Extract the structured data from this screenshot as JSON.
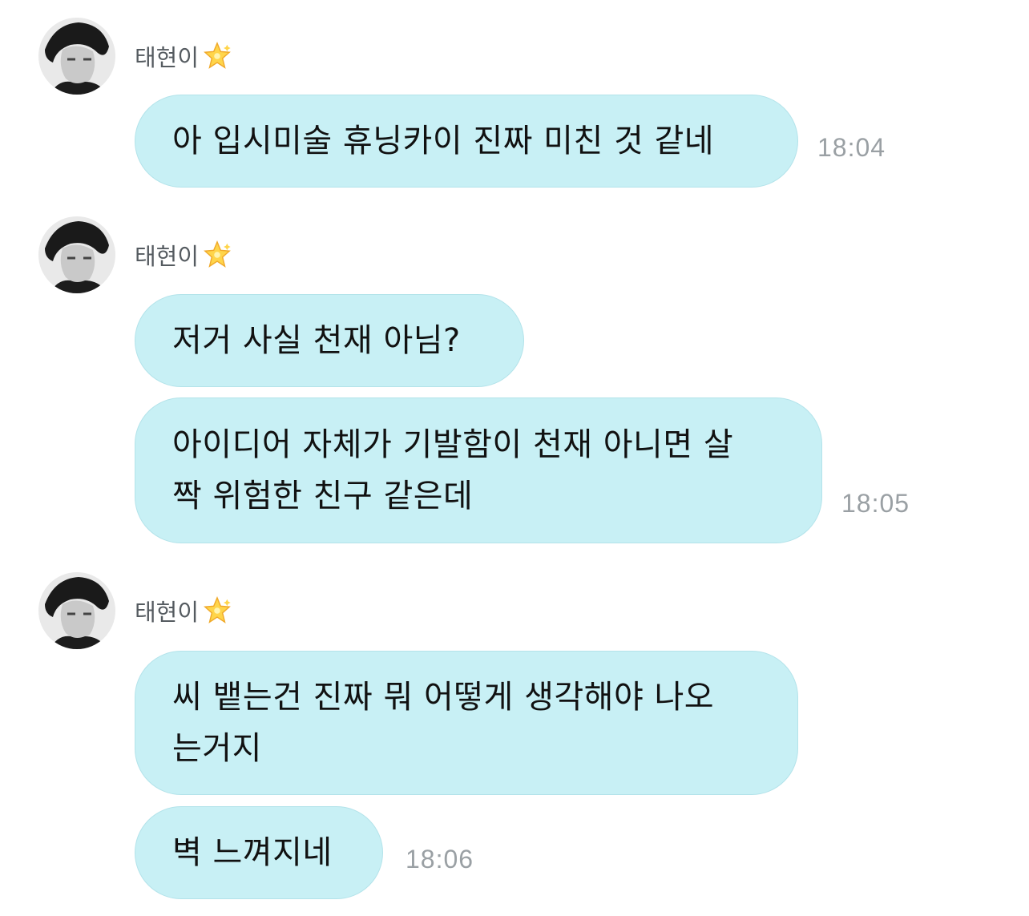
{
  "sender": {
    "name": "태현이",
    "badge_icon": "sparkle-star-icon"
  },
  "colors": {
    "bubble": "#c8f0f5",
    "bubble_border": "#b3e3ea",
    "text": "#111111",
    "time": "#9aa0a4",
    "name": "#555b60"
  },
  "messages": [
    {
      "text": "아 입시미술 휴닝카이 진짜 미친 것 같네",
      "time": "18:04"
    },
    {
      "text": "저거 사실 천재 아님?",
      "time": ""
    },
    {
      "text": "아이디어 자체가 기발함이 천재 아니면 살\n짝 위험한 친구 같은데",
      "time": "18:05"
    },
    {
      "text": "씨 뱉는건 진짜 뭐 어떻게 생각해야 나오\n는거지",
      "time": ""
    },
    {
      "text": "벽 느껴지네",
      "time": "18:06"
    }
  ]
}
